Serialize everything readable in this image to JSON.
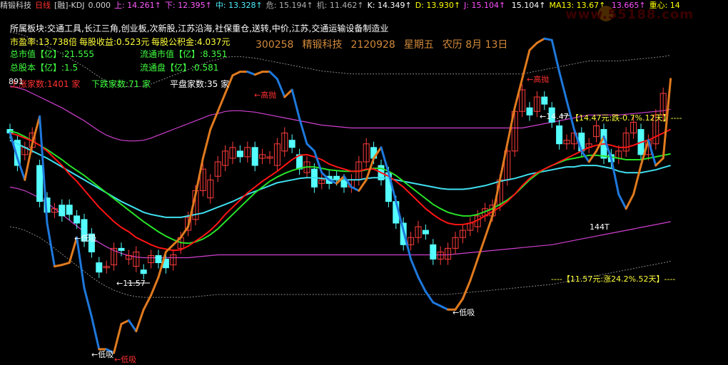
{
  "header": {
    "stock_name": "精锻科技",
    "period": "日线",
    "indicator": "[融]-KDJ",
    "value0": "0.000",
    "items": [
      {
        "label": "上:",
        "value": "14.261",
        "arrow": "↑",
        "color": "#ff5cff"
      },
      {
        "label": "下:",
        "value": "12.395",
        "arrow": "↑",
        "color": "#ff5cff"
      },
      {
        "label": "中:",
        "value": "13.328",
        "arrow": "↑",
        "color": "#4ef0ff"
      },
      {
        "label": "危:",
        "value": "15.194",
        "arrow": "↑",
        "color": "#b0b0b0"
      },
      {
        "label": "机:",
        "value": "11.462",
        "arrow": "↑",
        "color": "#b0b0b0"
      },
      {
        "label": "K:",
        "value": "14.349",
        "arrow": "↑",
        "color": "#ffffff"
      },
      {
        "label": "D:",
        "value": "13.930",
        "arrow": "↑",
        "color": "#ffff00"
      },
      {
        "label": "J:",
        "value": "15.104",
        "arrow": "↑",
        "color": "#ff4fff"
      },
      {
        "label": "",
        "value": "15.104",
        "arrow": "↑",
        "color": "#ffffff"
      },
      {
        "label": "MA13:",
        "value": "13.67",
        "arrow": "↑",
        "color": "#ffff00"
      },
      {
        "label": "",
        "value": "13.665",
        "arrow": "↑",
        "color": "#ff4fff"
      },
      {
        "label": "重心:",
        "value": "14",
        "arrow": "",
        "color": "#ffff00"
      }
    ]
  },
  "watermark": "www.55188.com",
  "info": {
    "sector": "所属板块:交通工具,长江三角,创业板,次新股,江苏沿海,社保重仓,送转,中价,江苏,交通运输设备制造业",
    "pe": "市盈率:13.738倍",
    "eps": "每股收益:0.523元",
    "fund": "每股公积金:4.037元",
    "mcap": "总市值【亿】:21.555",
    "float_mcap": "流通市值【亿】:8.351",
    "total_shares": "总股本【亿】:1.5",
    "float_shares": "流通盘【亿】:0.581",
    "up_count": "上涨家数:1401 家",
    "down_count": "下跌家数:71 家",
    "flat_count": "平盘家数:35 家"
  },
  "stockline": {
    "code": "300258",
    "name": "精锻科技",
    "date": "2120928",
    "weekday": "星期五",
    "lunar": "农历  8月  13日"
  },
  "annotations": {
    "val891": "891",
    "sell1": "←高抛",
    "sell2": "←高抛",
    "buy1": "←低吸",
    "buy2": "←低吸",
    "buy3": "←低吸",
    "buy4": "←低吸",
    "low_price": "←11.57",
    "high_price": "←14.47",
    "day144": "144T",
    "top_info": "【14.47元:跌-0.7%.12天】----",
    "bottom_info": "----【11.57元:涨24.2%.52天】----"
  },
  "colors": {
    "up_candle": "#ff3c3c",
    "down_candle": "#54ffff",
    "kdj_down": "#1e78dc",
    "kdj_up": "#e07a1e",
    "ma_red": "#ff1414",
    "ma_cyan": "#40e0f0",
    "ma_green": "#28e028",
    "band_magenta": "#d040d0",
    "band_dotted": "#888888"
  },
  "candles": [
    {
      "o": 13.6,
      "c": 13.55
    },
    {
      "o": 13.45,
      "c": 13.1
    },
    {
      "o": 13.25,
      "c": 13.35
    },
    {
      "o": 13.35,
      "c": 13.55
    },
    {
      "o": 13.1,
      "c": 12.6
    },
    {
      "o": 12.65,
      "c": 12.45
    },
    {
      "o": 12.45,
      "c": 12.5
    },
    {
      "o": 12.55,
      "c": 12.4
    },
    {
      "o": 12.55,
      "c": 12.42
    },
    {
      "o": 12.4,
      "c": 12.3
    },
    {
      "o": 12.35,
      "c": 12.05
    },
    {
      "o": 12.15,
      "c": 11.9
    },
    {
      "o": 11.75,
      "c": 11.62
    },
    {
      "o": 11.68,
      "c": 11.7
    },
    {
      "o": 11.72,
      "c": 11.95
    },
    {
      "o": 11.95,
      "c": 11.92
    },
    {
      "o": 11.8,
      "c": 11.85
    },
    {
      "o": 11.7,
      "c": 11.9
    },
    {
      "o": 11.65,
      "c": 11.6
    },
    {
      "o": 11.75,
      "c": 11.85
    },
    {
      "o": 11.85,
      "c": 11.75
    },
    {
      "o": 11.8,
      "c": 11.68
    },
    {
      "o": 11.72,
      "c": 11.86
    },
    {
      "o": 11.95,
      "c": 12.1
    },
    {
      "o": 12.2,
      "c": 12.38
    },
    {
      "o": 12.35,
      "c": 12.75
    },
    {
      "o": 12.75,
      "c": 13.05
    },
    {
      "o": 12.65,
      "c": 12.9
    },
    {
      "o": 12.95,
      "c": 13.15
    },
    {
      "o": 13.1,
      "c": 13.3
    },
    {
      "o": 13.2,
      "c": 13.35
    },
    {
      "o": 13.3,
      "c": 13.22
    },
    {
      "o": 13.22,
      "c": 13.35
    },
    {
      "o": 13.35,
      "c": 13.1
    },
    {
      "o": 13.2,
      "c": 13.25
    },
    {
      "o": 13.2,
      "c": 13.22
    },
    {
      "o": 13.1,
      "c": 13.4
    },
    {
      "o": 13.3,
      "c": 13.55
    },
    {
      "o": 13.45,
      "c": 13.35
    },
    {
      "o": 13.25,
      "c": 13.05
    },
    {
      "o": 13.0,
      "c": 13.15
    },
    {
      "o": 13.05,
      "c": 12.8
    },
    {
      "o": 12.85,
      "c": 12.9
    },
    {
      "o": 12.95,
      "c": 12.85
    },
    {
      "o": 12.95,
      "c": 12.9
    },
    {
      "o": 12.9,
      "c": 12.8
    },
    {
      "o": 12.8,
      "c": 12.9
    },
    {
      "o": 12.9,
      "c": 13.15
    },
    {
      "o": 13.15,
      "c": 13.4
    },
    {
      "o": 13.35,
      "c": 13.2
    },
    {
      "o": 13.1,
      "c": 12.9
    },
    {
      "o": 13.0,
      "c": 12.6
    },
    {
      "o": 12.6,
      "c": 12.3
    },
    {
      "o": 12.3,
      "c": 12.0
    },
    {
      "o": 12.0,
      "c": 12.1
    },
    {
      "o": 12.1,
      "c": 12.25
    },
    {
      "o": 12.2,
      "c": 12.15
    },
    {
      "o": 12.0,
      "c": 11.8
    },
    {
      "o": 11.8,
      "c": 11.9
    },
    {
      "o": 11.8,
      "c": 11.95
    },
    {
      "o": 11.95,
      "c": 12.1
    },
    {
      "o": 12.1,
      "c": 12.2
    },
    {
      "o": 12.2,
      "c": 12.3
    },
    {
      "o": 12.25,
      "c": 12.4
    },
    {
      "o": 12.4,
      "c": 12.5
    },
    {
      "o": 12.4,
      "c": 12.55
    },
    {
      "o": 12.55,
      "c": 12.9
    },
    {
      "o": 12.9,
      "c": 13.3
    },
    {
      "o": 13.3,
      "c": 13.85
    },
    {
      "o": 13.85,
      "c": 14.15
    },
    {
      "o": 13.9,
      "c": 13.8
    },
    {
      "o": 13.85,
      "c": 14.05
    },
    {
      "o": 14.05,
      "c": 13.95
    },
    {
      "o": 13.9,
      "c": 13.7
    },
    {
      "o": 13.65,
      "c": 13.4
    },
    {
      "o": 13.4,
      "c": 13.45
    },
    {
      "o": 13.4,
      "c": 13.55
    },
    {
      "o": 13.55,
      "c": 13.3
    },
    {
      "o": 13.35,
      "c": 13.4
    },
    {
      "o": 13.5,
      "c": 13.65
    },
    {
      "o": 13.6,
      "c": 13.2
    },
    {
      "o": 13.25,
      "c": 13.15
    },
    {
      "o": 13.2,
      "c": 13.3
    },
    {
      "o": 13.3,
      "c": 13.55
    },
    {
      "o": 13.55,
      "c": 13.7
    },
    {
      "o": 13.6,
      "c": 13.25
    },
    {
      "o": 13.25,
      "c": 13.45
    },
    {
      "o": 13.4,
      "c": 13.8
    },
    {
      "o": 13.8,
      "c": 14.1
    }
  ],
  "ma_red": [
    13.55,
    13.52,
    13.48,
    13.44,
    13.38,
    13.3,
    13.2,
    13.1,
    12.98,
    12.88,
    12.76,
    12.64,
    12.52,
    12.42,
    12.32,
    12.24,
    12.18,
    12.1,
    12.05,
    12.0,
    11.96,
    11.94,
    11.92,
    11.93,
    11.98,
    12.05,
    12.12,
    12.2,
    12.3,
    12.42,
    12.52,
    12.62,
    12.72,
    12.8,
    12.88,
    12.95,
    13.02,
    13.1,
    13.18,
    13.24,
    13.25,
    13.22,
    13.18,
    13.12,
    13.08,
    13.05,
    13.02,
    13.02,
    13.05,
    13.05,
    13.0,
    12.95,
    12.88,
    12.8,
    12.7,
    12.6,
    12.5,
    12.42,
    12.35,
    12.3,
    12.28,
    12.28,
    12.3,
    12.34,
    12.4,
    12.46,
    12.52,
    12.6,
    12.7,
    12.82,
    12.92,
    13.0,
    13.05,
    13.1,
    13.15,
    13.2,
    13.25,
    13.3,
    13.35,
    13.38,
    13.4,
    13.38,
    13.35,
    13.35,
    13.38,
    13.42,
    13.45,
    13.5,
    13.55,
    13.6
  ],
  "ma_cyan": [
    13.45,
    13.4,
    13.35,
    13.3,
    13.25,
    13.2,
    13.14,
    13.08,
    13.02,
    12.96,
    12.9,
    12.84,
    12.78,
    12.72,
    12.66,
    12.6,
    12.55,
    12.5,
    12.45,
    12.42,
    12.4,
    12.38,
    12.38,
    12.38,
    12.4,
    12.42,
    12.44,
    12.48,
    12.52,
    12.56,
    12.6,
    12.65,
    12.7,
    12.74,
    12.78,
    12.82,
    12.86,
    12.88,
    12.9,
    12.92,
    12.93,
    12.93,
    12.92,
    12.91,
    12.9,
    12.9,
    12.9,
    12.9,
    12.92,
    12.93,
    12.93,
    12.92,
    12.9,
    12.88,
    12.86,
    12.84,
    12.82,
    12.8,
    12.78,
    12.77,
    12.77,
    12.77,
    12.78,
    12.8,
    12.82,
    12.85,
    12.88,
    12.9,
    12.92,
    12.95,
    12.98,
    13.0,
    13.02,
    13.04,
    13.06,
    13.08,
    13.08,
    13.1,
    13.1,
    13.1,
    13.08,
    13.06,
    13.02,
    13.0,
    13.0,
    13.0,
    13.02,
    13.04,
    13.07,
    13.1
  ],
  "ma_green": [
    13.58,
    13.55,
    13.5,
    13.44,
    13.38,
    13.32,
    13.25,
    13.18,
    13.1,
    13.03,
    12.96,
    12.88,
    12.8,
    12.72,
    12.64,
    12.56,
    12.48,
    12.4,
    12.32,
    12.25,
    12.18,
    12.12,
    12.07,
    12.03,
    12.02,
    12.04,
    12.08,
    12.14,
    12.22,
    12.32,
    12.42,
    12.52,
    12.62,
    12.72,
    12.8,
    12.88,
    12.94,
    12.99,
    13.03,
    13.06,
    13.08,
    13.08,
    13.06,
    13.04,
    13.03,
    13.02,
    13.02,
    13.02,
    13.04,
    13.06,
    13.06,
    13.02,
    12.96,
    12.88,
    12.8,
    12.72,
    12.64,
    12.56,
    12.5,
    12.45,
    12.42,
    12.4,
    12.4,
    12.42,
    12.46,
    12.5,
    12.56,
    12.62,
    12.7,
    12.8,
    12.9,
    12.98,
    13.05,
    13.1,
    13.14,
    13.18,
    13.2,
    13.22,
    13.24,
    13.24,
    13.23,
    13.22,
    13.2,
    13.18,
    13.18,
    13.18,
    13.2,
    13.22,
    13.24,
    13.26
  ],
  "band_upper": [
    14.2,
    14.18,
    14.15,
    14.1,
    14.05,
    14.0,
    13.95,
    13.9,
    13.84,
    13.78,
    13.72,
    13.65,
    13.58,
    13.52,
    13.48,
    13.45,
    13.44,
    13.44,
    13.45,
    13.48,
    13.52,
    13.56,
    13.6,
    13.64,
    13.68,
    13.72,
    13.76,
    13.8,
    13.82,
    13.85,
    13.86,
    13.86,
    13.85,
    13.84,
    13.82,
    13.8,
    13.78,
    13.76,
    13.74,
    13.72,
    13.7,
    13.68,
    13.66,
    13.65,
    13.64,
    13.63,
    13.62,
    13.62,
    13.62,
    13.62,
    13.62,
    13.62,
    13.62,
    13.62,
    13.62,
    13.62,
    13.62,
    13.62,
    13.62,
    13.62,
    13.62,
    13.62,
    13.62,
    13.62,
    13.62,
    13.62,
    13.62,
    13.62,
    13.62,
    13.62,
    13.64,
    13.66,
    13.68,
    13.7,
    13.72,
    13.74,
    13.76,
    13.78,
    13.8,
    13.8,
    13.8,
    13.8,
    13.8,
    13.81,
    13.82,
    13.83,
    13.84,
    13.85,
    13.86,
    13.88
  ],
  "band_lower": [
    12.8,
    12.78,
    12.75,
    12.7,
    12.65,
    12.58,
    12.5,
    12.42,
    12.34,
    12.26,
    12.18,
    12.1,
    12.03,
    11.97,
    11.92,
    11.88,
    11.85,
    11.83,
    11.82,
    11.82,
    11.82,
    11.82,
    11.82,
    11.82,
    11.82,
    11.83,
    11.84,
    11.85,
    11.86,
    11.86,
    11.86,
    11.86,
    11.86,
    11.86,
    11.86,
    11.86,
    11.86,
    11.86,
    11.86,
    11.86,
    11.86,
    11.86,
    11.86,
    11.86,
    11.86,
    11.86,
    11.86,
    11.86,
    11.86,
    11.86,
    11.86,
    11.86,
    11.86,
    11.86,
    11.86,
    11.86,
    11.86,
    11.86,
    11.86,
    11.86,
    11.87,
    11.88,
    11.89,
    11.9,
    11.91,
    11.92,
    11.93,
    11.94,
    11.95,
    11.96,
    11.97,
    11.98,
    11.99,
    12.0,
    12.02,
    12.04,
    12.06,
    12.08,
    12.1,
    12.12,
    12.14,
    12.16,
    12.18,
    12.2,
    12.22,
    12.24,
    12.26,
    12.28,
    12.3,
    12.32
  ],
  "kdj_line": [
    [
      0,
      13.55
    ],
    [
      1,
      13.2
    ],
    [
      2,
      12.9
    ],
    [
      3,
      13.4
    ],
    [
      4,
      13.78
    ],
    [
      5,
      12.3
    ],
    [
      6,
      11.7
    ],
    [
      7,
      11.72
    ],
    [
      8,
      11.75
    ],
    [
      9,
      12.1
    ],
    [
      10,
      11.4
    ],
    [
      11,
      11.0
    ],
    [
      12,
      10.55
    ],
    [
      13,
      10.55
    ],
    [
      14,
      10.5
    ],
    [
      15,
      10.9
    ],
    [
      16,
      10.95
    ],
    [
      17,
      10.8
    ],
    [
      18,
      11.1
    ],
    [
      19,
      11.3
    ],
    [
      20,
      11.55
    ],
    [
      21,
      11.9
    ],
    [
      22,
      12.0
    ],
    [
      23,
      12.1
    ],
    [
      24,
      12.25
    ],
    [
      25,
      12.7
    ],
    [
      26,
      13.2
    ],
    [
      27,
      13.6
    ],
    [
      28,
      13.85
    ],
    [
      29,
      14.1
    ],
    [
      30,
      14.35
    ],
    [
      31,
      14.4
    ],
    [
      32,
      14.4
    ],
    [
      33,
      14.36
    ],
    [
      34,
      14.4
    ],
    [
      35,
      14.4
    ],
    [
      36,
      14.3
    ],
    [
      37,
      14.05
    ],
    [
      38,
      14.15
    ],
    [
      39,
      13.75
    ],
    [
      40,
      13.4
    ],
    [
      41,
      13.3
    ],
    [
      42,
      13.0
    ],
    [
      43,
      12.9
    ],
    [
      44,
      12.85
    ],
    [
      45,
      12.95
    ],
    [
      46,
      12.8
    ],
    [
      47,
      12.75
    ],
    [
      48,
      12.9
    ],
    [
      49,
      13.2
    ],
    [
      50,
      13.35
    ],
    [
      51,
      13.0
    ],
    [
      52,
      12.6
    ],
    [
      53,
      12.2
    ],
    [
      54,
      11.8
    ],
    [
      55,
      11.55
    ],
    [
      56,
      11.35
    ],
    [
      57,
      11.2
    ],
    [
      58,
      11.15
    ],
    [
      59,
      11.1
    ],
    [
      60,
      11.1
    ],
    [
      61,
      11.25
    ],
    [
      62,
      11.5
    ],
    [
      63,
      11.8
    ],
    [
      64,
      12.1
    ],
    [
      65,
      12.4
    ],
    [
      66,
      12.9
    ],
    [
      67,
      13.4
    ],
    [
      68,
      13.9
    ],
    [
      69,
      14.3
    ],
    [
      70,
      14.7
    ],
    [
      71,
      14.8
    ],
    [
      72,
      14.86
    ],
    [
      73,
      14.84
    ],
    [
      74,
      14.4
    ],
    [
      75,
      14.0
    ],
    [
      76,
      13.6
    ],
    [
      77,
      13.3
    ],
    [
      78,
      13.15
    ],
    [
      79,
      13.3
    ],
    [
      80,
      13.5
    ],
    [
      81,
      13.2
    ],
    [
      82,
      12.7
    ],
    [
      83,
      12.5
    ],
    [
      84,
      12.7
    ],
    [
      85,
      13.1
    ],
    [
      86,
      13.45
    ],
    [
      87,
      13.1
    ],
    [
      88,
      13.2
    ],
    [
      89,
      14.3
    ]
  ]
}
